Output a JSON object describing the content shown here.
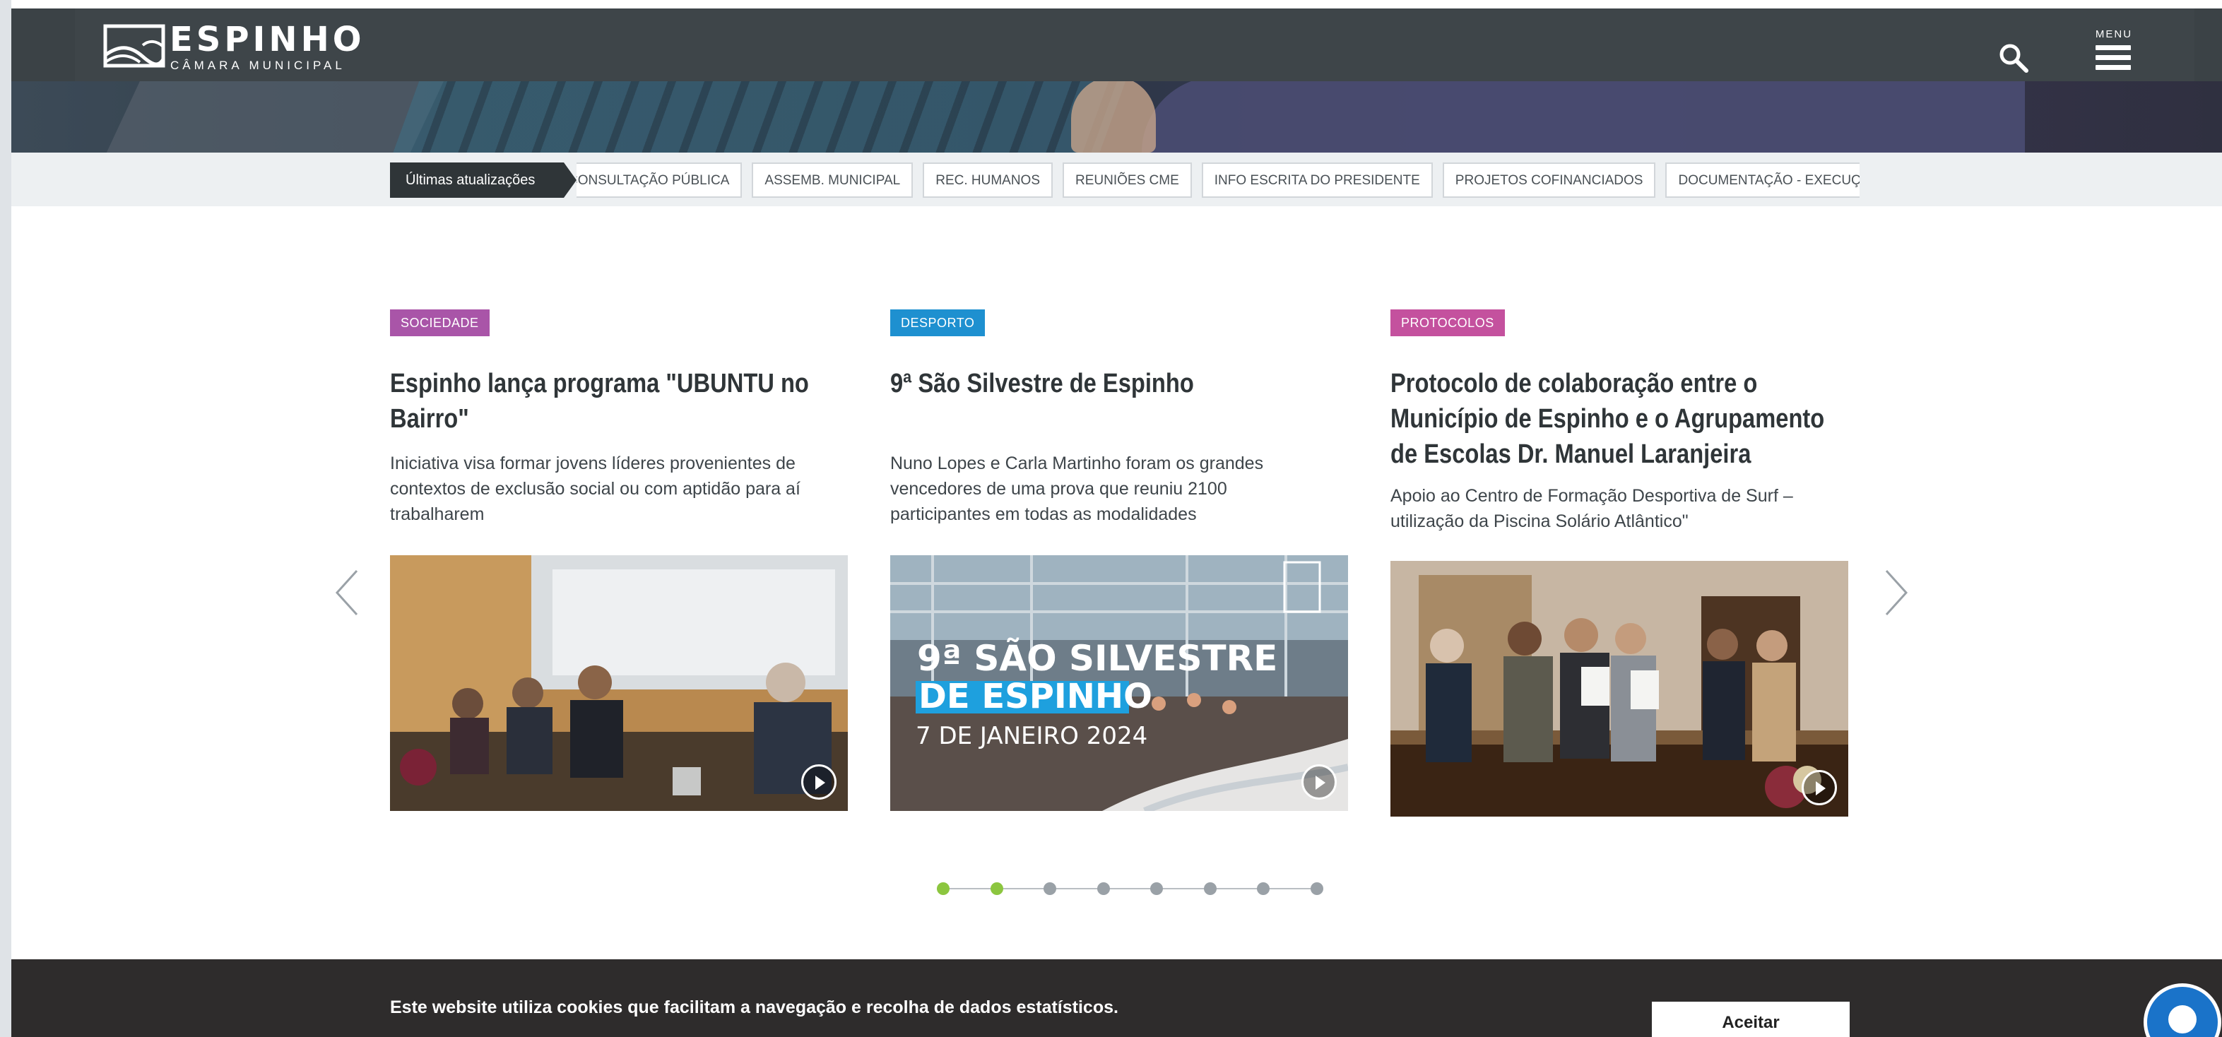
{
  "header": {
    "logo_title": "ESPINHO",
    "logo_subtitle": "CÂMARA MUNICIPAL",
    "menu_label": "MENU"
  },
  "updates": {
    "label": "Últimas atualizações",
    "tags": [
      "CONSULTAÇÃO PÚBLICA",
      "ASSEMB. MUNICIPAL",
      "REC. HUMANOS",
      "REUNIÕES CME",
      "INFO ESCRITA DO PRESIDENTE",
      "PROJETOS COFINANCIADOS",
      "DOCUMENTAÇÃO - EXECUÇÃO ORÇ"
    ]
  },
  "cards": [
    {
      "category": "SOCIEDADE",
      "category_color": "#a955a8",
      "title": "Espinho lança programa \"UBUNTU no Bairro\"",
      "description": "Iniciativa visa formar jovens líderes provenientes de contextos de exclusão social ou com aptidão para aí trabalharem"
    },
    {
      "category": "DESPORTO",
      "category_color": "#1e90d0",
      "title": "9ª São Silvestre de Espinho",
      "description": "Nuno Lopes e Carla Martinho foram os grandes vencedores de uma prova que reuniu 2100 participantes em todas as modalidades",
      "image_text_line1": "9ª SÃO SILVESTRE",
      "image_text_line2": "DE ESPINHO",
      "image_text_line3": "7 DE JANEIRO 2024"
    },
    {
      "category": "PROTOCOLOS",
      "category_color": "#c4519e",
      "title": "Protocolo de colaboração entre o Município de Espinho e o Agrupamento de Escolas Dr. Manuel Laranjeira",
      "description": "Apoio ao Centro de Formação Desportiva de Surf – utilização da Piscina Solário Atlântico\""
    }
  ],
  "carousel": {
    "total_dots": 8,
    "active_dots": [
      0,
      1
    ]
  },
  "cookie": {
    "message": "Este website utiliza cookies que facilitam a navegação e recolha de dados estatísticos.",
    "accept_label": "Aceitar"
  },
  "icons": {
    "search": "search-icon",
    "menu": "hamburger-menu-icon",
    "prev": "chevron-left-icon",
    "next": "chevron-right-icon",
    "play": "play-circle-icon",
    "help": "accessibility-help-icon"
  }
}
